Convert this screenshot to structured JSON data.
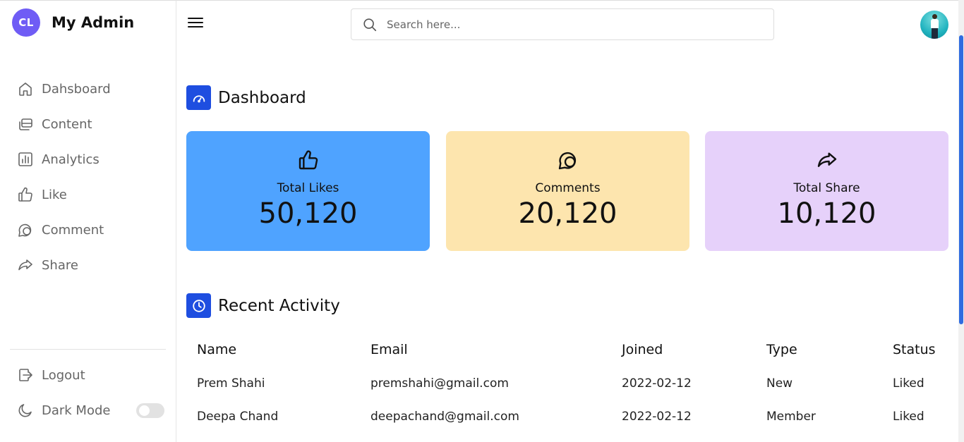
{
  "brand": {
    "initials": "CL",
    "name": "My Admin",
    "logo_color": "#6f5cf5"
  },
  "sidebar": {
    "items": [
      {
        "label": "Dahsboard",
        "icon": "home-icon"
      },
      {
        "label": "Content",
        "icon": "content-icon"
      },
      {
        "label": "Analytics",
        "icon": "analytics-icon"
      },
      {
        "label": "Like",
        "icon": "thumbs-up-icon"
      },
      {
        "label": "Comment",
        "icon": "comment-icon"
      },
      {
        "label": "Share",
        "icon": "share-icon"
      }
    ],
    "bottom": [
      {
        "label": "Logout",
        "icon": "logout-icon"
      },
      {
        "label": "Dark Mode",
        "icon": "moon-icon",
        "toggle_on": false
      }
    ]
  },
  "topbar": {
    "search_placeholder": "Search here...",
    "avatar_icon": "user-avatar"
  },
  "dashboard": {
    "title": "Dashboard",
    "icon": "speedometer-icon",
    "accent": "#1e4ee0",
    "cards": [
      {
        "title": "Total Likes",
        "value": "50,120",
        "icon": "thumbs-up-icon",
        "color": "#4fa3ff"
      },
      {
        "title": "Comments",
        "value": "20,120",
        "icon": "comments-icon",
        "color": "#fde5ae"
      },
      {
        "title": "Total Share",
        "value": "10,120",
        "icon": "share-icon",
        "color": "#e6d1fa"
      }
    ]
  },
  "recent_activity": {
    "title": "Recent Activity",
    "icon": "clock-icon",
    "columns": [
      "Name",
      "Email",
      "Joined",
      "Type",
      "Status"
    ],
    "rows": [
      [
        "Prem Shahi",
        "premshahi@gmail.com",
        "2022-02-12",
        "New",
        "Liked"
      ],
      [
        "Deepa Chand",
        "deepachand@gmail.com",
        "2022-02-12",
        "Member",
        "Liked"
      ]
    ]
  }
}
